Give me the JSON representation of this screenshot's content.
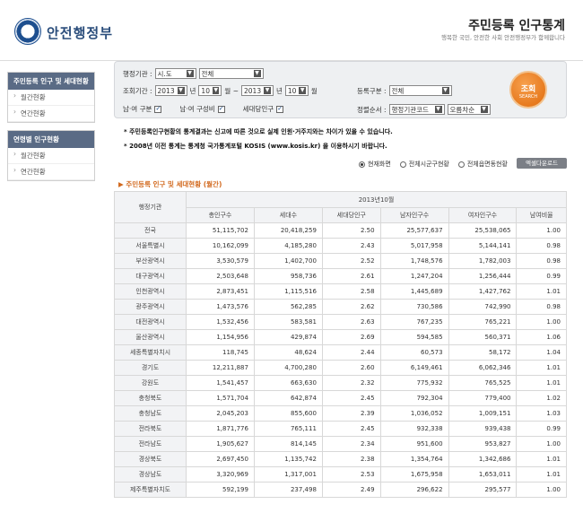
{
  "header": {
    "logo_text": "안전행정부",
    "title": "주민등록 인구통계",
    "subtitle": "행복한 국민, 안전한 사회 안전행정부가 함께합니다"
  },
  "sidebar": {
    "groups": [
      {
        "title": "주민등록 인구 및 세대현황",
        "items": [
          "월간현황",
          "연간현황"
        ]
      },
      {
        "title": "연령별 인구현황",
        "items": [
          "월간현황",
          "연간현황"
        ]
      }
    ]
  },
  "search": {
    "admin_label": "행정기관 :",
    "admin_level": "시.도",
    "admin_value": "전체",
    "period_label": "조회기간 :",
    "from_year": "2013",
    "from_month": "10",
    "to_year": "2013",
    "to_month": "10",
    "year_unit": "년",
    "month_unit": "월 ~",
    "month_unit_end": "월",
    "register_label": "등록구분 :",
    "register_value": "전체",
    "gender_split_label": "남·여 구분",
    "gender_ratio_label": "남·여 구성비",
    "household_label": "세대당인구",
    "sort_label": "정렬순서 :",
    "sort_value": "행정기관코드",
    "order_value": "오름차순",
    "button_main": "조회",
    "button_sub": "SEARCH"
  },
  "notices": [
    "* 주민등록인구현황의 통계결과는 신고에 따른 것으로 실제 인원·거주지와는 차이가 있을 수 있습니다.",
    "* 2008년 이전 통계는 통계청 국가통계포털 KOSIS (www.kosis.kr) 을 이용하시기 바랍니다."
  ],
  "view_options": {
    "current": "현재화면",
    "all_sigungu": "전체시군구현황",
    "all_eupmyeondong": "전체읍면동현황",
    "download": "엑셀다운로드"
  },
  "section_title": "▶ 주민등록 인구 및 세대현황 (월간)",
  "table": {
    "region_header": "행정기관",
    "period_header": "2013년10월",
    "columns": [
      "총인구수",
      "세대수",
      "세대당인구",
      "남자인구수",
      "여자인구수",
      "남여비율"
    ],
    "rows": [
      [
        "전국",
        "51,115,702",
        "20,418,259",
        "2.50",
        "25,577,637",
        "25,538,065",
        "1.00"
      ],
      [
        "서울특별시",
        "10,162,099",
        "4,185,280",
        "2.43",
        "5,017,958",
        "5,144,141",
        "0.98"
      ],
      [
        "부산광역시",
        "3,530,579",
        "1,402,700",
        "2.52",
        "1,748,576",
        "1,782,003",
        "0.98"
      ],
      [
        "대구광역시",
        "2,503,648",
        "958,736",
        "2.61",
        "1,247,204",
        "1,256,444",
        "0.99"
      ],
      [
        "인천광역시",
        "2,873,451",
        "1,115,516",
        "2.58",
        "1,445,689",
        "1,427,762",
        "1.01"
      ],
      [
        "광주광역시",
        "1,473,576",
        "562,285",
        "2.62",
        "730,586",
        "742,990",
        "0.98"
      ],
      [
        "대전광역시",
        "1,532,456",
        "583,581",
        "2.63",
        "767,235",
        "765,221",
        "1.00"
      ],
      [
        "울산광역시",
        "1,154,956",
        "429,874",
        "2.69",
        "594,585",
        "560,371",
        "1.06"
      ],
      [
        "세종특별자치시",
        "118,745",
        "48,624",
        "2.44",
        "60,573",
        "58,172",
        "1.04"
      ],
      [
        "경기도",
        "12,211,887",
        "4,700,280",
        "2.60",
        "6,149,461",
        "6,062,346",
        "1.01"
      ],
      [
        "강원도",
        "1,541,457",
        "663,630",
        "2.32",
        "775,932",
        "765,525",
        "1.01"
      ],
      [
        "충청북도",
        "1,571,704",
        "642,874",
        "2.45",
        "792,304",
        "779,400",
        "1.02"
      ],
      [
        "충청남도",
        "2,045,203",
        "855,600",
        "2.39",
        "1,036,052",
        "1,009,151",
        "1.03"
      ],
      [
        "전라북도",
        "1,871,776",
        "765,111",
        "2.45",
        "932,338",
        "939,438",
        "0.99"
      ],
      [
        "전라남도",
        "1,905,627",
        "814,145",
        "2.34",
        "951,600",
        "953,827",
        "1.00"
      ],
      [
        "경상북도",
        "2,697,450",
        "1,135,742",
        "2.38",
        "1,354,764",
        "1,342,686",
        "1.01"
      ],
      [
        "경상남도",
        "3,320,969",
        "1,317,001",
        "2.53",
        "1,675,958",
        "1,653,011",
        "1.01"
      ],
      [
        "제주특별자치도",
        "592,199",
        "237,498",
        "2.49",
        "296,622",
        "295,577",
        "1.00"
      ]
    ]
  }
}
